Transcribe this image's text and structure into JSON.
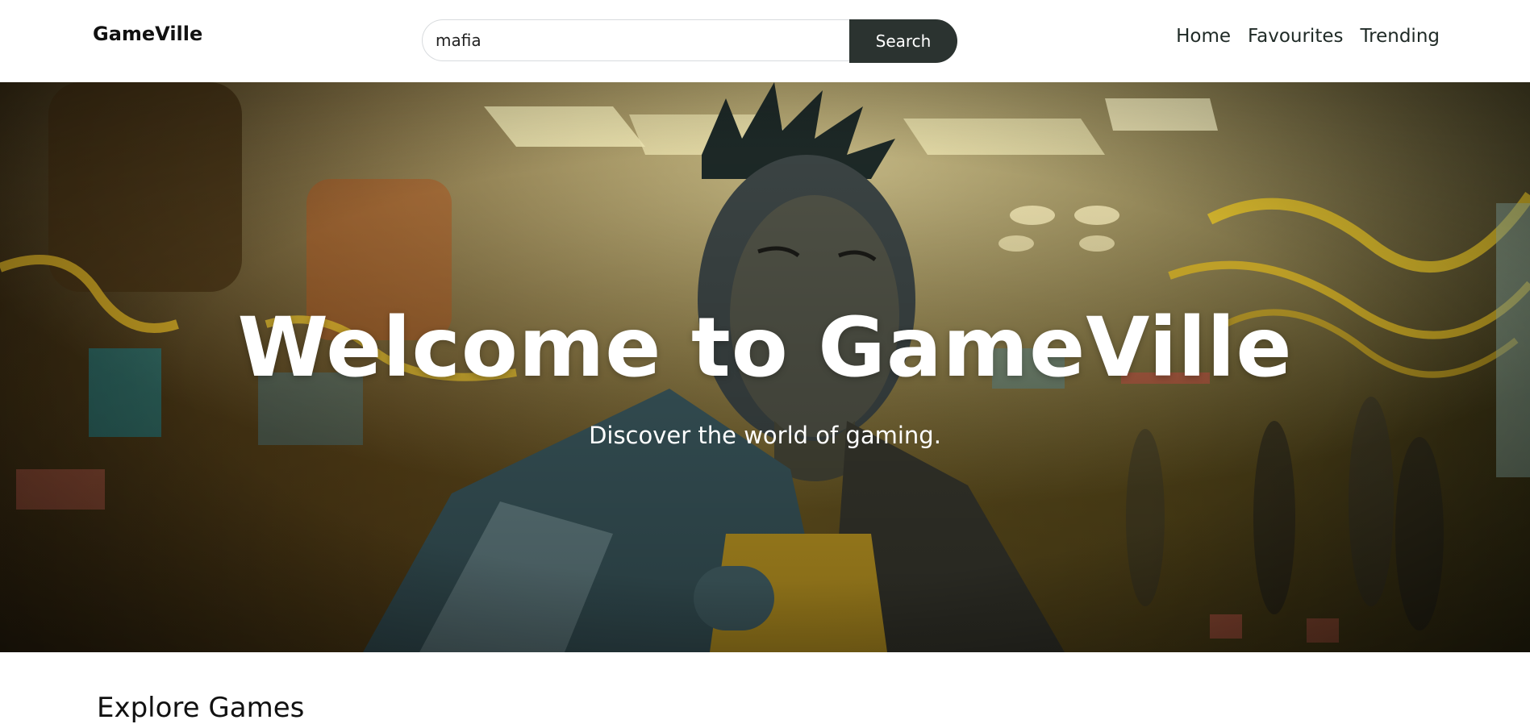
{
  "header": {
    "brand": "GameVille",
    "search": {
      "value": "mafia",
      "button_label": "Search"
    },
    "nav": [
      {
        "label": "Home"
      },
      {
        "label": "Favourites"
      },
      {
        "label": "Trending"
      }
    ]
  },
  "hero": {
    "title": "Welcome to GameVille",
    "subtitle": "Discover the world of gaming.",
    "image": "cyberpunk-character-banner"
  },
  "main": {
    "section_title": "Explore Games"
  },
  "colors": {
    "search_button_bg": "#2b3330",
    "hero_text": "#ffffff",
    "hero_tone": "#c9a23a"
  }
}
